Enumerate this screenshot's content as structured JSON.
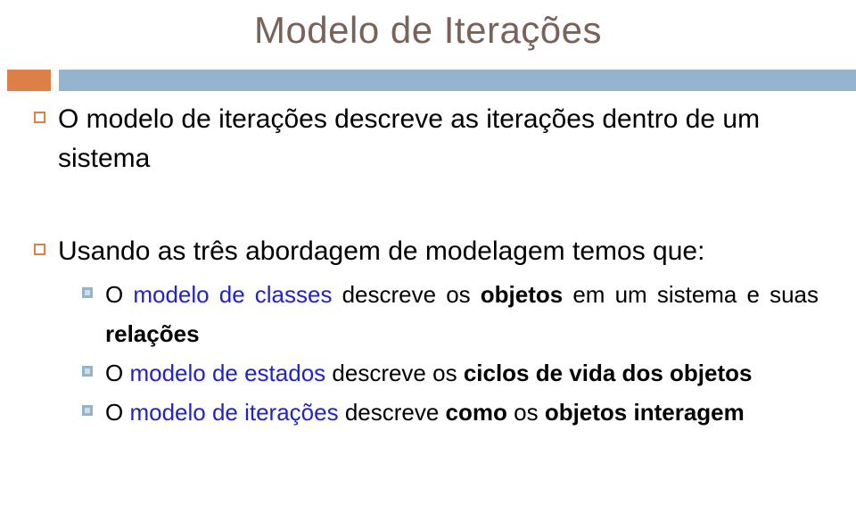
{
  "slide": {
    "title": "Modelo de Iterações",
    "theme": {
      "title_color": "#7a6259",
      "accent_orange": "#dd8047",
      "accent_blue": "#94b3cc",
      "emphasis_blue": "#2222cc",
      "body_color": "#000000",
      "background": "#ffffff"
    },
    "divider": {
      "accent_bar_name": "orange-accent-bar",
      "main_bar_name": "blue-divider-bar"
    },
    "bullets": [
      {
        "level": 1,
        "marker": "hollow-square-orange",
        "text": "O modelo de iterações descreve as iterações dentro de um sistema"
      },
      {
        "level": 1,
        "marker": "hollow-square-orange",
        "text": "Usando as três abordagem de modelagem temos que:"
      }
    ],
    "sub_bullets": [
      {
        "level": 2,
        "marker": "filled-square-blue",
        "runs": [
          {
            "text": "O ",
            "style": "plain"
          },
          {
            "text": "modelo de classes",
            "style": "blue"
          },
          {
            "text": " descreve os ",
            "style": "plain"
          },
          {
            "text": "objetos",
            "style": "bold"
          },
          {
            "text": " em um sistema e suas ",
            "style": "plain"
          },
          {
            "text": "relações",
            "style": "bold"
          }
        ]
      },
      {
        "level": 2,
        "marker": "filled-square-blue",
        "runs": [
          {
            "text": "O ",
            "style": "plain"
          },
          {
            "text": "modelo de estados",
            "style": "blue"
          },
          {
            "text": " descreve os ",
            "style": "plain"
          },
          {
            "text": "ciclos de vida dos objetos",
            "style": "bold"
          }
        ]
      },
      {
        "level": 2,
        "marker": "filled-square-blue",
        "runs": [
          {
            "text": "O ",
            "style": "plain"
          },
          {
            "text": "modelo de iterações",
            "style": "blue"
          },
          {
            "text": " descreve ",
            "style": "plain"
          },
          {
            "text": "como",
            "style": "bold"
          },
          {
            "text": " os ",
            "style": "plain"
          },
          {
            "text": "objetos interagem",
            "style": "bold"
          }
        ]
      }
    ],
    "bullet1_runs": [
      {
        "text": "O modelo de iterações descreve as iterações dentro de um sistema",
        "style": "plain"
      }
    ],
    "bullet2_runs": [
      {
        "text": "Usando as três abordagem de modelagem temos que:",
        "style": "plain"
      }
    ]
  }
}
